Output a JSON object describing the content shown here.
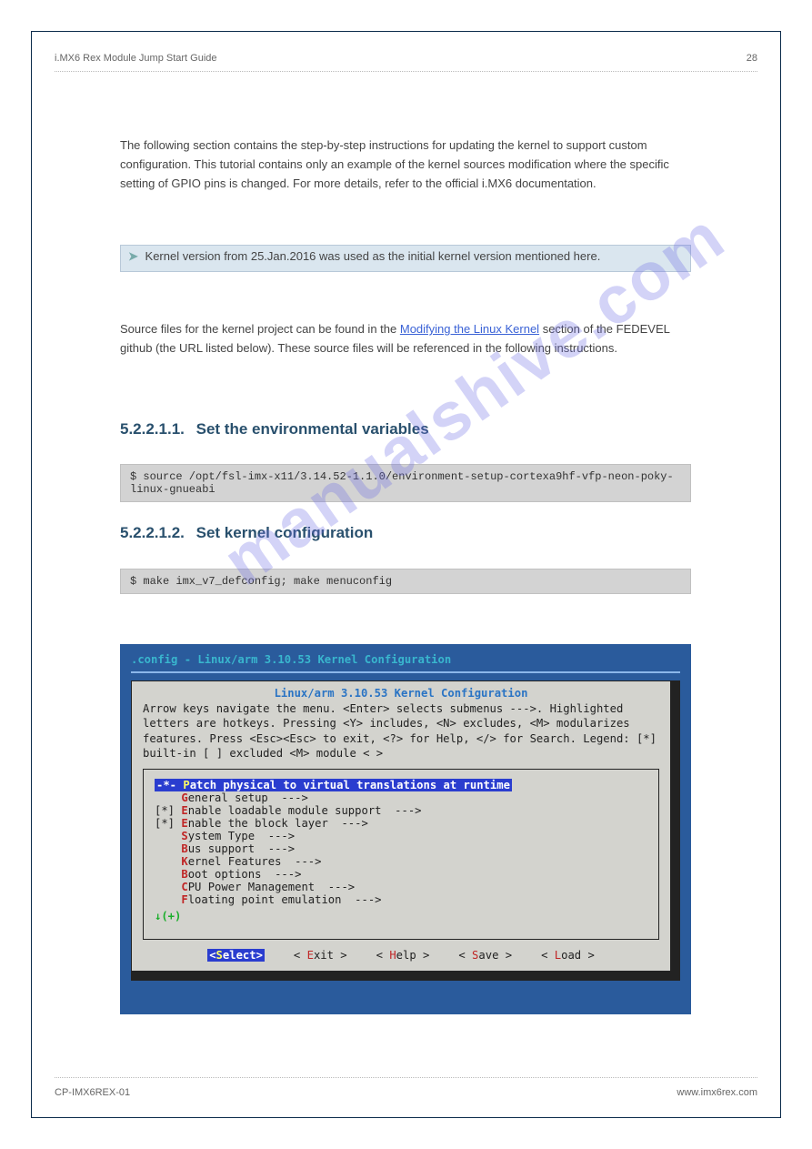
{
  "header": {
    "left": "i.MX6 Rex Module Jump Start Guide",
    "right": "28"
  },
  "intro": "   The following section contains the step-by-step instructions for updating the kernel to support custom configuration. This tutorial contains only an example of the kernel sources modification where the specific setting of GPIO pins is changed. For more details, refer to the official i.MX6 documentation.",
  "note": {
    "text": "Kernel version from 25.Jan.2016 was used as the initial kernel version mentioned here."
  },
  "source_text": {
    "pre": "   Source files for the kernel project can be found in the ",
    "link_text": "Modifying the Linux Kernel",
    "post": " section of the FEDEVEL github (the URL listed below). These source files will be referenced in the following instructions."
  },
  "section1": {
    "num": "5.2.2.1.1.",
    "title": "Set the environmental variables"
  },
  "cmd1": "$ source /opt/fsl-imx-x11/3.14.52-1.1.0/environment-setup-cortexa9hf-vfp-neon-poky-linux-gnueabi",
  "section2": {
    "num": "5.2.2.1.2.",
    "title": "Set kernel configuration"
  },
  "cmd2": "$ make imx_v7_defconfig; make menuconfig",
  "terminal": {
    "title": ".config - Linux/arm 3.10.53 Kernel Configuration",
    "subtitle": "Linux/arm 3.10.53 Kernel Configuration",
    "help": "Arrow keys navigate the menu.  <Enter> selects submenus --->.  Highlighted letters are hotkeys.  Pressing <Y> includes, <N> excludes, <M> modularizes features.  Press <Esc><Esc> to exit, <?> for Help, </> for Search.  Legend: [*] built-in  [ ] excluded  <M> module  < >",
    "menu": [
      {
        "prefix": "-*- ",
        "hot": "P",
        "rest": "atch physical to virtual translations at runtime",
        "selected": true
      },
      {
        "prefix": "    ",
        "hot": "G",
        "rest": "eneral setup  --->"
      },
      {
        "prefix": "[*] ",
        "hot": "E",
        "rest": "nable loadable module support  --->"
      },
      {
        "prefix": "[*] ",
        "hot": "E",
        "rest": "nable the block layer  --->"
      },
      {
        "prefix": "    ",
        "hot": "S",
        "rest": "ystem Type  --->"
      },
      {
        "prefix": "    ",
        "hot": "B",
        "rest": "us support  --->"
      },
      {
        "prefix": "    ",
        "hot": "K",
        "rest": "ernel Features  --->"
      },
      {
        "prefix": "    ",
        "hot": "B",
        "rest": "oot options  --->"
      },
      {
        "prefix": "    ",
        "hot": "C",
        "rest": "PU Power Management  --->"
      },
      {
        "prefix": "    ",
        "hot": "F",
        "rest": "loating point emulation  --->"
      }
    ],
    "plus_indicator": "↓(+)",
    "buttons": [
      {
        "hot": "S",
        "rest": "elect",
        "selected": true,
        "rawL": "<",
        "rawR": ">"
      },
      {
        "hot": "E",
        "rest": "xit",
        "rawL": "< ",
        "rawR": " >"
      },
      {
        "hot": "H",
        "rest": "elp",
        "rawL": "< ",
        "rawR": " >"
      },
      {
        "hot": "S",
        "rest": "ave",
        "rawL": "< ",
        "rawR": " >"
      },
      {
        "hot": "L",
        "rest": "oad",
        "rawL": "< ",
        "rawR": " >"
      }
    ]
  },
  "footer": {
    "left": "CP-IMX6REX-01",
    "right": "www.imx6rex.com"
  },
  "watermark": "manualshive.com"
}
